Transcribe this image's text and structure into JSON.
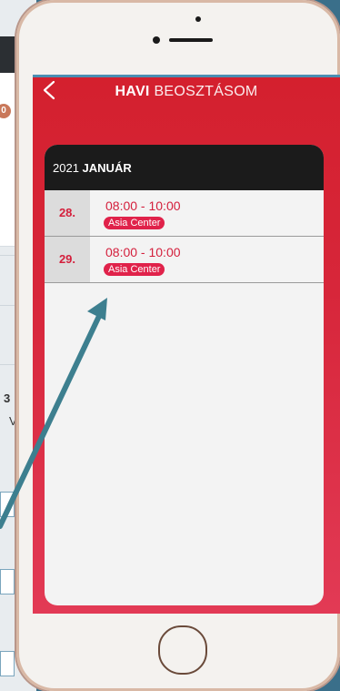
{
  "background": {
    "badge_count": "0",
    "row_number": "3",
    "row_letter": "V"
  },
  "header": {
    "title_bold": "HAVI",
    "title_light": "BEOSZTÁSOM"
  },
  "calendar": {
    "year": "2021",
    "month": "JANUÁR",
    "entries": [
      {
        "day": "28.",
        "time": "08:00 - 10:00",
        "location": "Asia Center"
      },
      {
        "day": "29.",
        "time": "08:00 - 10:00",
        "location": "Asia Center"
      }
    ]
  },
  "colors": {
    "accent": "#d41f3c",
    "header_bg": "#1b1b1b",
    "annotation_arrow": "#3d7f8f"
  },
  "icons": {
    "back": "chevron-left-icon",
    "home": "home-button-icon"
  }
}
